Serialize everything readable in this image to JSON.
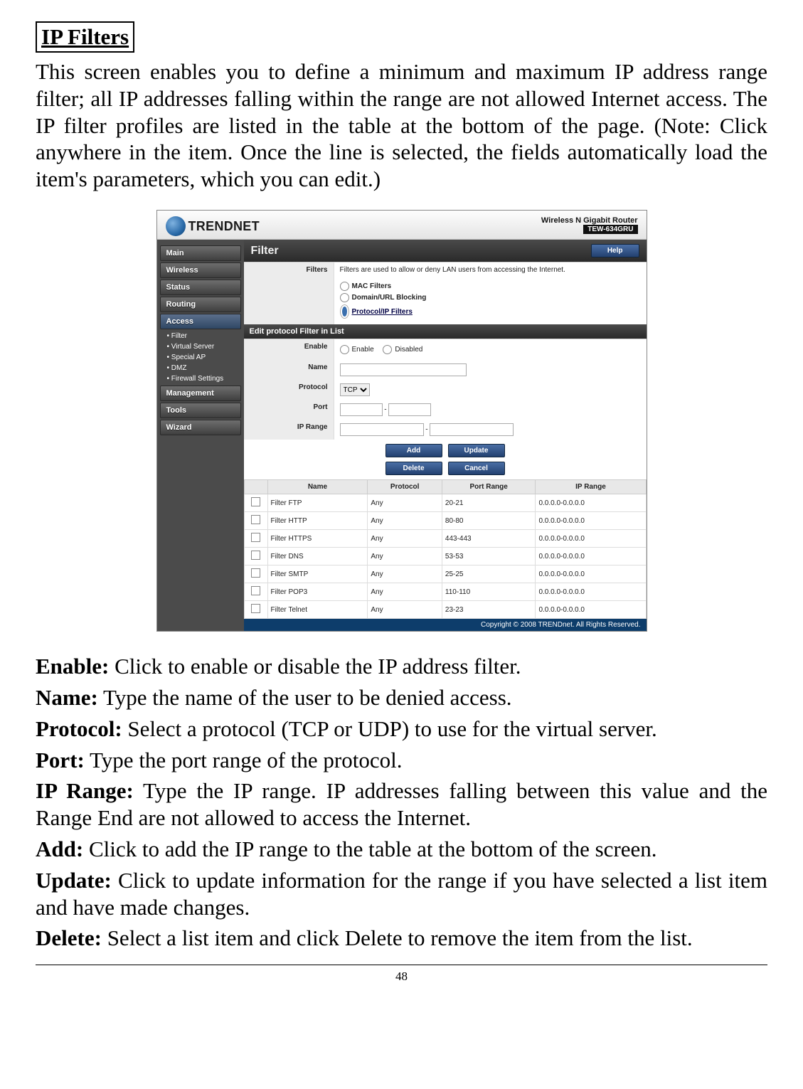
{
  "doc": {
    "heading": "IP Filters",
    "intro": "This screen enables you to define a minimum and maximum IP address range filter; all IP addresses falling within the range are not allowed Internet access. The IP filter profiles are listed in the table at the bottom of the page. (Note: Click anywhere in the item. Once the line is selected, the fields automatically load the item's parameters, which you can edit.)",
    "defs": {
      "enable_l": "Enable:",
      "enable_t": " Click to enable or disable the IP address filter.",
      "name_l": "Name:",
      "name_t": " Type the name of the user to be denied access.",
      "protocol_l": "Protocol:",
      "protocol_t": " Select a protocol (TCP or UDP) to use for the virtual server.",
      "port_l": "Port:",
      "port_t": " Type the port range of the protocol.",
      "iprange_l": "IP Range:",
      "iprange_t": " Type the IP range. IP addresses falling between this value and the Range End are not allowed to access the Internet.",
      "add_l": "Add:",
      "add_t": " Click to add the IP range to the table at the bottom of the screen.",
      "update_l": "Update:",
      "update_t": " Click to update information for the range if you have selected a list item and have made changes.",
      "delete_l": "Delete:",
      "delete_t": " Select a list item and click Delete to remove the item from the list."
    },
    "page_number": "48"
  },
  "ui": {
    "brand": "TRENDNET",
    "model_line": "Wireless N Gigabit Router",
    "model_sub": "TEW-634GRU",
    "sidebar": {
      "items": [
        "Main",
        "Wireless",
        "Status",
        "Routing",
        "Access",
        "Management",
        "Tools",
        "Wizard"
      ],
      "sub": [
        "Filter",
        "Virtual Server",
        "Special AP",
        "DMZ",
        "Firewall Settings"
      ]
    },
    "page_title": "Filter",
    "help": "Help",
    "filters": {
      "label": "Filters",
      "desc": "Filters are used to allow or deny LAN users from accessing the Internet.",
      "opt_mac": "MAC Filters",
      "opt_url": "Domain/URL Blocking",
      "opt_ip": "Protocol/IP Filters"
    },
    "edit": {
      "title": "Edit protocol Filter in List",
      "enable_label": "Enable",
      "enable_on": "Enable",
      "enable_off": "Disabled",
      "name_label": "Name",
      "protocol_label": "Protocol",
      "protocol_value": "TCP",
      "port_label": "Port",
      "port_sep": "-",
      "iprange_label": "IP Range",
      "iprange_sep": "-"
    },
    "buttons": {
      "add": "Add",
      "update": "Update",
      "delete": "Delete",
      "cancel": "Cancel"
    },
    "table": {
      "headers": [
        "",
        "Name",
        "Protocol",
        "Port Range",
        "IP Range"
      ],
      "rows": [
        {
          "name": "Filter FTP",
          "protocol": "Any",
          "port": "20-21",
          "ip": "0.0.0.0-0.0.0.0"
        },
        {
          "name": "Filter HTTP",
          "protocol": "Any",
          "port": "80-80",
          "ip": "0.0.0.0-0.0.0.0"
        },
        {
          "name": "Filter HTTPS",
          "protocol": "Any",
          "port": "443-443",
          "ip": "0.0.0.0-0.0.0.0"
        },
        {
          "name": "Filter DNS",
          "protocol": "Any",
          "port": "53-53",
          "ip": "0.0.0.0-0.0.0.0"
        },
        {
          "name": "Filter SMTP",
          "protocol": "Any",
          "port": "25-25",
          "ip": "0.0.0.0-0.0.0.0"
        },
        {
          "name": "Filter POP3",
          "protocol": "Any",
          "port": "110-110",
          "ip": "0.0.0.0-0.0.0.0"
        },
        {
          "name": "Filter Telnet",
          "protocol": "Any",
          "port": "23-23",
          "ip": "0.0.0.0-0.0.0.0"
        }
      ]
    },
    "copyright": "Copyright © 2008 TRENDnet. All Rights Reserved."
  }
}
